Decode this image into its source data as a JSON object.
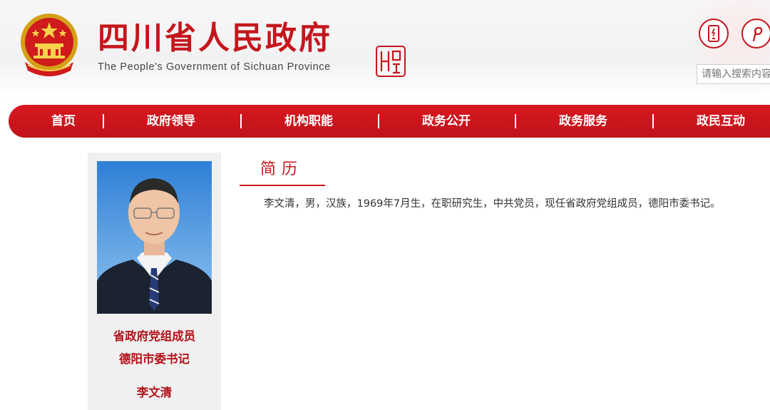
{
  "header": {
    "title": "四川省人民政府",
    "subtitle": "The People's Government of Sichuan Province",
    "brand_color": "#c5161d",
    "icons": [
      "national-emblem-icon",
      "seal-icon",
      "mobile-icon",
      "weibo-icon"
    ]
  },
  "search": {
    "placeholder": "请输入搜索内容"
  },
  "nav": {
    "items": [
      {
        "label": "首页"
      },
      {
        "label": "政府领导"
      },
      {
        "label": "机构职能"
      },
      {
        "label": "政务公开"
      },
      {
        "label": "政务服务"
      },
      {
        "label": "政民互动"
      }
    ]
  },
  "profile": {
    "positions": [
      "省政府党组成员",
      "德阳市委书记"
    ],
    "name": "李文清"
  },
  "resume": {
    "title": "简历",
    "text": "李文清，男，汉族，1969年7月生，在职研究生，中共党员，现任省政府党组成员，德阳市委书记。"
  }
}
